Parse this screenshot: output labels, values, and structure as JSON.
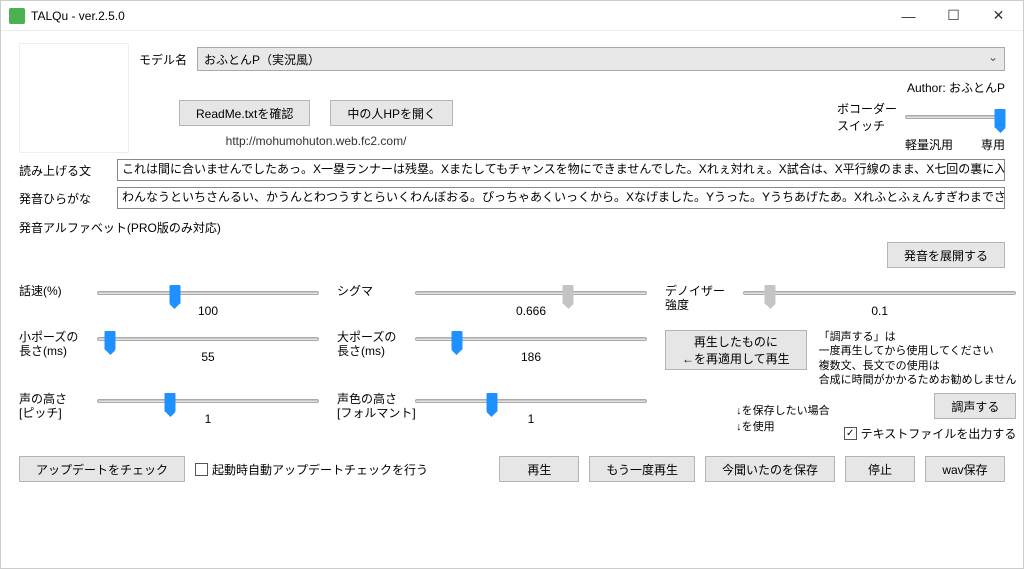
{
  "window": {
    "title": "TALQu - ver.2.5.0"
  },
  "model": {
    "label": "モデル名",
    "selected": "おふとんP（実況風）"
  },
  "author": {
    "label": "Author: おふとんP"
  },
  "buttons": {
    "readme": "ReadMe.txtを確認",
    "openhp": "中の人HPを開く",
    "url": "http://mohumohuton.web.fc2.com/"
  },
  "vocoder": {
    "label": "ボコーダー\nスイッチ",
    "option1": "軽量汎用",
    "option2": "専用"
  },
  "texts": {
    "read_label": "読み上げる文",
    "read_value": "これは間に合いませんでしたあっ。X一塁ランナーは残塁。Xまたしてもチャンスを物にできませんでした。Xれぇ対れぇ。X試合は、X平行線のまま、X七回の裏に入ります",
    "hira_label": "発音ひらがな",
    "hira_value": "わんなうといちさんるい、かうんとわつうすとらいくわんぼおる。ぴっちゃあくいっくから。Xなげました。Yうった。Yうちあげたあ。Xれふとふぇんすぎわまでさがりますが、Xこれわ",
    "pro_label": "発音アルファベット(PRO版のみ対応)",
    "expand_btn": "発音を展開する"
  },
  "sliders": {
    "speed": {
      "label": "話速(%)",
      "value": "100",
      "pos": 35
    },
    "sigma": {
      "label": "シグマ",
      "value": "0.666",
      "pos": 66,
      "gray": true
    },
    "denoise": {
      "label": "デノイザー\n強度",
      "value": "0.1",
      "pos": 10,
      "gray": true
    },
    "spause": {
      "label": "小ポーズの\n長さ(ms)",
      "value": "55",
      "pos": 6
    },
    "lpause": {
      "label": "大ポーズの\n長さ(ms)",
      "value": "186",
      "pos": 18
    },
    "pitch": {
      "label": "声の高さ\n[ピッチ]",
      "value": "1",
      "pos": 33
    },
    "formant": {
      "label": "声色の高さ\n[フォルマント]",
      "value": "1",
      "pos": 33
    }
  },
  "replay_btn": "再生したものに\n←を再適用して再生",
  "note_tune": "「調声する」は\n一度再生してから使用してください\n複数文、長文での使用は\n合成に時間がかかるためお勧めしません",
  "tune_btn": "調声する",
  "save_note": "↓を保存したい場合\n↓を使用",
  "output_txt": "テキストファイルを出力する",
  "bottom": {
    "update_check": "アップデートをチェック",
    "auto_update": "起動時自動アップデートチェックを行う",
    "play": "再生",
    "play_again": "もう一度再生",
    "save_now": "今聞いたのを保存",
    "stop": "停止",
    "save_wav": "wav保存"
  }
}
